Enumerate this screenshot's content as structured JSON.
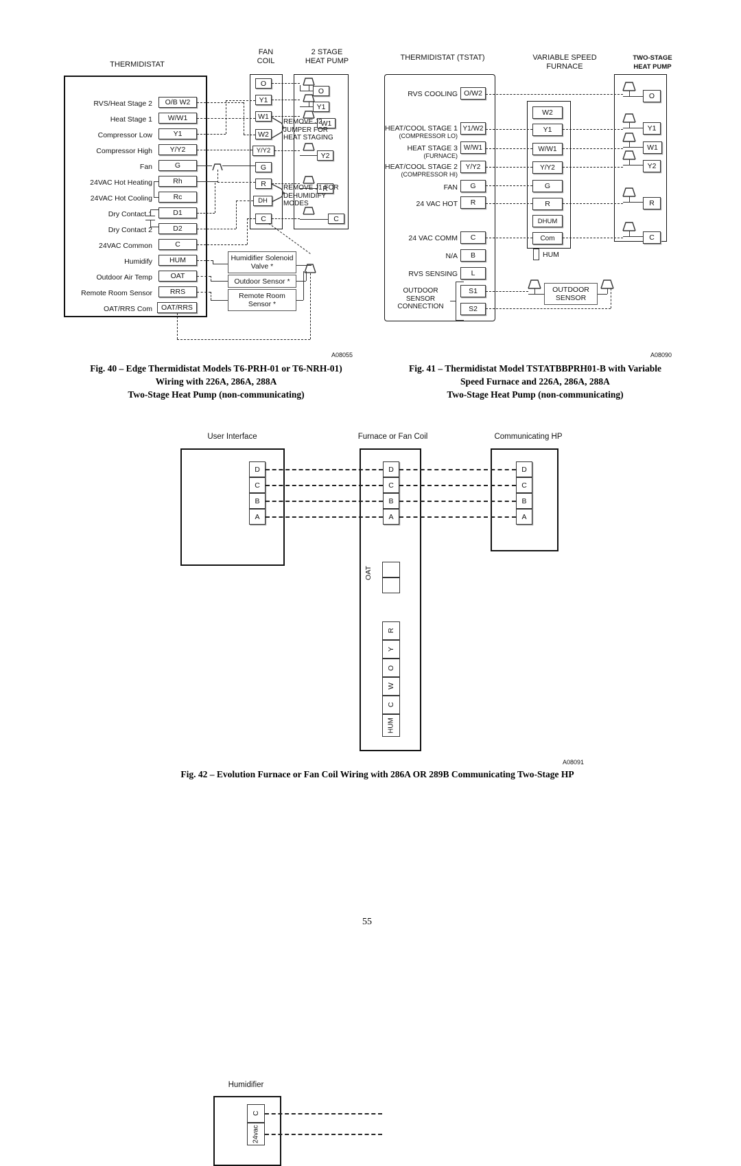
{
  "page": {
    "number": "55"
  },
  "fig40": {
    "id_code": "A08055",
    "headers": {
      "thermidistat": "THERMIDISTAT",
      "fan_coil": "FAN\nCOIL",
      "heat_pump": "2 STAGE\nHEAT PUMP"
    },
    "tstat_rows": [
      {
        "label": "RVS/Heat Stage 2",
        "terminal": "O/B W2"
      },
      {
        "label": "Heat Stage 1",
        "terminal": "W/W1"
      },
      {
        "label": "Compressor Low",
        "terminal": "Y1"
      },
      {
        "label": "Compressor High",
        "terminal": "Y/Y2"
      },
      {
        "label": "Fan",
        "terminal": "G"
      },
      {
        "label": "24VAC Hot Heating",
        "terminal": "Rh"
      },
      {
        "label": "24VAC Hot Cooling",
        "terminal": "Rc"
      },
      {
        "label": "Dry Contact 1",
        "terminal": "D1"
      },
      {
        "label": "Dry Contact 2",
        "terminal": "D2"
      },
      {
        "label": "24VAC Common",
        "terminal": "C"
      },
      {
        "label": "Humidify",
        "terminal": "HUM"
      },
      {
        "label": "Outdoor Air Temp",
        "terminal": "OAT"
      },
      {
        "label": "Remote Room Sensor",
        "terminal": "RRS"
      },
      {
        "label": "OAT/RRS Com",
        "terminal": "OAT/RRS"
      }
    ],
    "fancoil_terminals": [
      "O",
      "Y1",
      "W1",
      "W2",
      "Y/Y2",
      "G",
      "R",
      "DH",
      "C"
    ],
    "heatpump_terminals": [
      "O",
      "Y1",
      "W1",
      "Y2",
      "R",
      "C"
    ],
    "notes": {
      "j2": "REMOVE J2\nJUMPER FOR\nHEAT STAGING",
      "j1": "REMOVE J1 FOR\nDEHUMIDIFY\nMODES"
    },
    "accessories": [
      "Humidifier Solenoid\nValve  *",
      "Outdoor Sensor *",
      "Remote Room\nSensor *"
    ],
    "caption": "Fig. 40 – Edge Thermidistat Models T6-PRH-01 or T6-NRH-01)\nWiring with 226A, 286A, 288A\nTwo-Stage Heat Pump (non-communicating)"
  },
  "fig41": {
    "id_code": "A08090",
    "headers": {
      "thermidistat": "THERMIDISTAT (TSTAT)",
      "furnace": "VARIABLE SPEED\nFURNACE",
      "heat_pump": "TWO-STAGE\nHEAT PUMP"
    },
    "tstat_rows": [
      {
        "label": "RVS COOLING",
        "sub": "",
        "terminal": "O/W2"
      },
      {
        "label": "HEAT/COOL STAGE 1",
        "sub": "(COMPRESSOR LO)",
        "terminal": "Y1/W2"
      },
      {
        "label": "HEAT STAGE 3",
        "sub": "(FURNACE)",
        "terminal": "W/W1"
      },
      {
        "label": "HEAT/COOL STAGE 2",
        "sub": "(COMPRESSOR HI)",
        "terminal": "Y/Y2"
      },
      {
        "label": "FAN",
        "sub": "",
        "terminal": "G"
      },
      {
        "label": "24 VAC HOT",
        "sub": "",
        "terminal": "R"
      },
      {
        "label": "24 VAC COMM",
        "sub": "",
        "terminal": "C"
      },
      {
        "label": "N/A",
        "sub": "",
        "terminal": "B"
      },
      {
        "label": "RVS SENSING",
        "sub": "",
        "terminal": "L"
      },
      {
        "label": "",
        "sub": "",
        "terminal": "S1"
      },
      {
        "label": "",
        "sub": "",
        "terminal": "S2"
      }
    ],
    "outdoor_sensor_connection_label": "OUTDOOR\nSENSOR\nCONNECTION",
    "furnace_terminals": [
      "W2",
      "Y1",
      "W/W1",
      "Y/Y2",
      "G",
      "R",
      "DHUM",
      "Com"
    ],
    "furnace_hum_label": "HUM",
    "heatpump_terminals": [
      "O",
      "Y1",
      "W1",
      "Y2",
      "R",
      "C"
    ],
    "outdoor_sensor_box": "OUTDOOR\nSENSOR",
    "caption": "Fig. 41 – Thermidistat Model TSTATBBPRH01-B with Variable\nSpeed Furnace and 226A, 286A, 288A\nTwo-Stage Heat Pump (non-communicating)"
  },
  "fig42": {
    "id_code": "A08091",
    "headers": {
      "user_interface": "User Interface",
      "furnace": "Furnace or Fan Coil",
      "heat_pump": "Communicating HP",
      "humidifier": "Humidifier"
    },
    "ui_terminals": [
      "D",
      "C",
      "B",
      "A"
    ],
    "furnace_comm_terminals": [
      "D",
      "C",
      "B",
      "A"
    ],
    "hp_terminals": [
      "D",
      "C",
      "B",
      "A"
    ],
    "oat_label": "OAT",
    "furnace_strip_terminals": [
      "R",
      "Y",
      "O",
      "W",
      "C",
      "HUM"
    ],
    "humidifier_terminals": [
      "C",
      "24vac"
    ],
    "caption": "Fig. 42 – Evolution Furnace or Fan Coil Wiring with 286A OR 289B Communicating Two-Stage HP"
  }
}
